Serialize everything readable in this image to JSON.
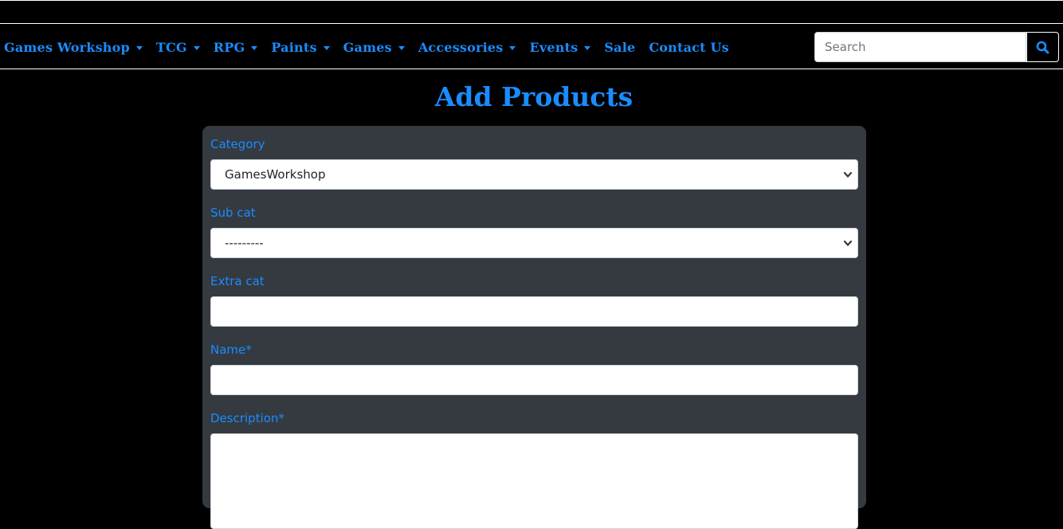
{
  "nav": {
    "items": [
      {
        "label": "Games Workshop",
        "dropdown": true
      },
      {
        "label": "TCG",
        "dropdown": true
      },
      {
        "label": "RPG",
        "dropdown": true
      },
      {
        "label": "Paints",
        "dropdown": true
      },
      {
        "label": "Games",
        "dropdown": true
      },
      {
        "label": "Accessories",
        "dropdown": true
      },
      {
        "label": "Events",
        "dropdown": true
      },
      {
        "label": "Sale",
        "dropdown": false
      },
      {
        "label": "Contact Us",
        "dropdown": false
      }
    ],
    "search": {
      "placeholder": "Search",
      "value": "",
      "icon": "search-icon"
    }
  },
  "page": {
    "title": "Add Products"
  },
  "form": {
    "category": {
      "label": "Category",
      "selected": "GamesWorkshop"
    },
    "sub_cat": {
      "label": "Sub cat",
      "selected": "---------"
    },
    "extra_cat": {
      "label": "Extra cat",
      "value": ""
    },
    "name": {
      "label": "Name*",
      "value": ""
    },
    "description": {
      "label": "Description*",
      "value": ""
    }
  },
  "colors": {
    "accent": "#1a8cff",
    "background": "#000000",
    "card": "#343a40"
  }
}
